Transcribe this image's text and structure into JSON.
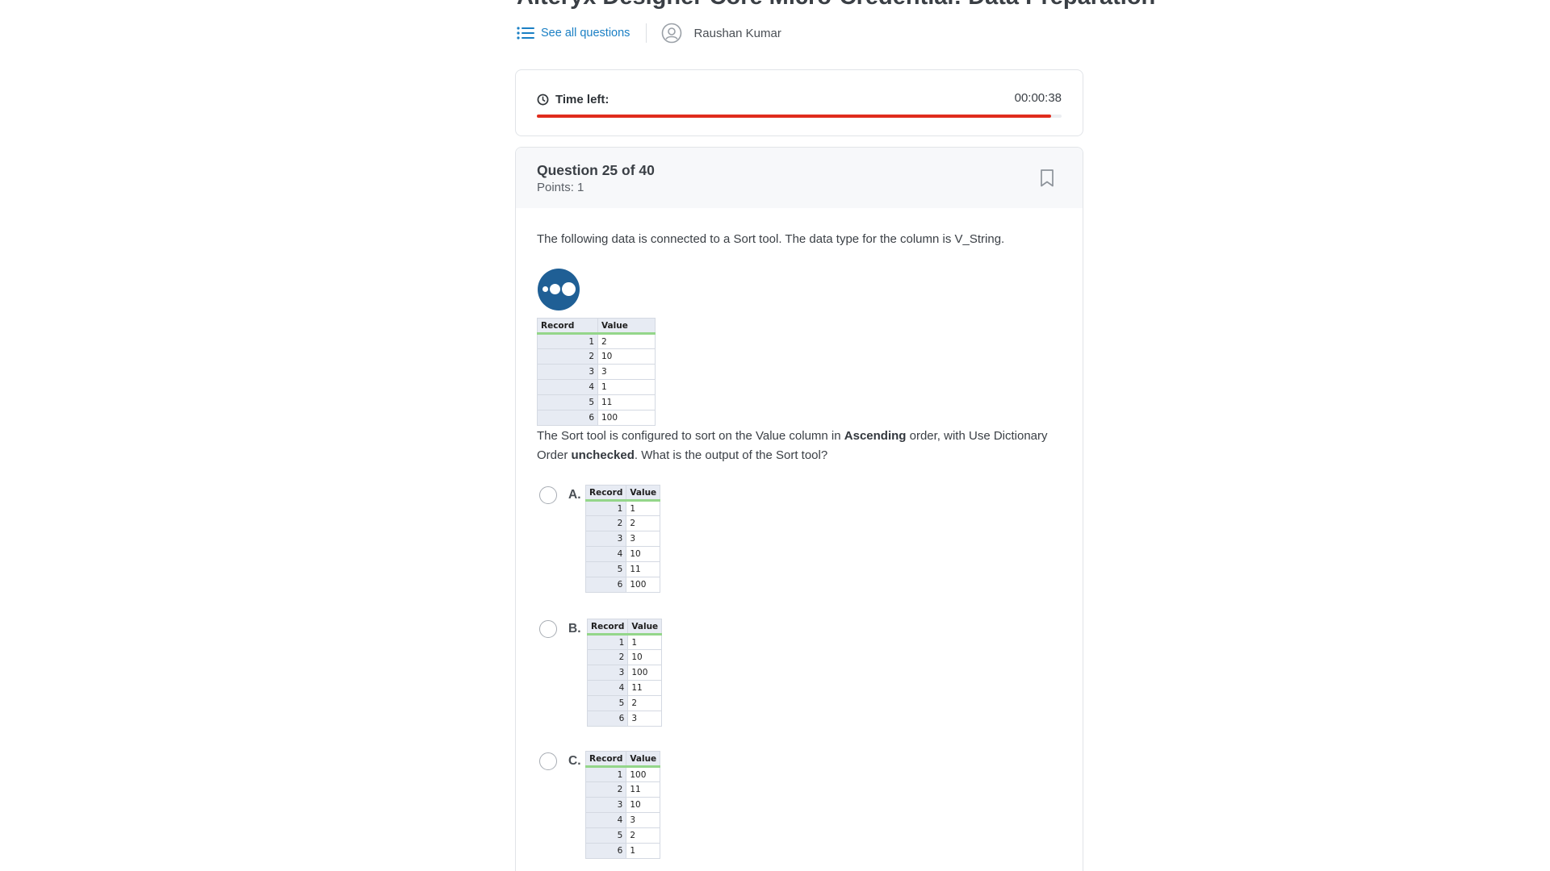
{
  "page": {
    "title": "Alteryx Designer Core Micro-Credential: Data Preparation"
  },
  "subnav": {
    "see_all_label": "See all questions",
    "user_name": "Raushan Kumar"
  },
  "timer": {
    "label": "Time left:",
    "value": "00:00:38",
    "progress_fraction": 0.98
  },
  "question": {
    "number_label": "Question 25 of 40",
    "points_label": "Points: 1",
    "intro_text": "The following data is connected to a Sort tool. The data type for the column is V_String.",
    "prompt_part1": "The Sort tool is configured to sort on the Value column in ",
    "prompt_bold1": "Ascending",
    "prompt_part2": " order, with Use Dictionary Order ",
    "prompt_bold2": "unchecked",
    "prompt_part3": ". What is the output of the Sort tool?",
    "input_table": {
      "headers": [
        "Record",
        "Value"
      ],
      "rows": [
        [
          "1",
          "2"
        ],
        [
          "2",
          "10"
        ],
        [
          "3",
          "3"
        ],
        [
          "4",
          "1"
        ],
        [
          "5",
          "11"
        ],
        [
          "6",
          "100"
        ]
      ]
    }
  },
  "options": [
    {
      "letter": "A.",
      "table": {
        "headers": [
          "Record",
          "Value"
        ],
        "rows": [
          [
            "1",
            "1"
          ],
          [
            "2",
            "2"
          ],
          [
            "3",
            "3"
          ],
          [
            "4",
            "10"
          ],
          [
            "5",
            "11"
          ],
          [
            "6",
            "100"
          ]
        ]
      }
    },
    {
      "letter": "B.",
      "table": {
        "headers": [
          "Record",
          "Value"
        ],
        "rows": [
          [
            "1",
            "1"
          ],
          [
            "2",
            "10"
          ],
          [
            "3",
            "100"
          ],
          [
            "4",
            "11"
          ],
          [
            "5",
            "2"
          ],
          [
            "6",
            "3"
          ]
        ]
      }
    },
    {
      "letter": "C.",
      "table": {
        "headers": [
          "Record",
          "Value"
        ],
        "rows": [
          [
            "1",
            "100"
          ],
          [
            "2",
            "11"
          ],
          [
            "3",
            "10"
          ],
          [
            "4",
            "3"
          ],
          [
            "5",
            "2"
          ],
          [
            "6",
            "1"
          ]
        ]
      }
    }
  ],
  "icons": {
    "list": "list-icon",
    "user": "user-circle-icon",
    "clock": "clock-icon",
    "bookmark": "bookmark-icon",
    "logo": "alteryx-logo"
  },
  "colors": {
    "accent_link": "#1a7fc4",
    "timer_bar": "#e02c1c",
    "logo_blue": "#1f5f95",
    "sheet_header_underline": "#94d68a"
  }
}
